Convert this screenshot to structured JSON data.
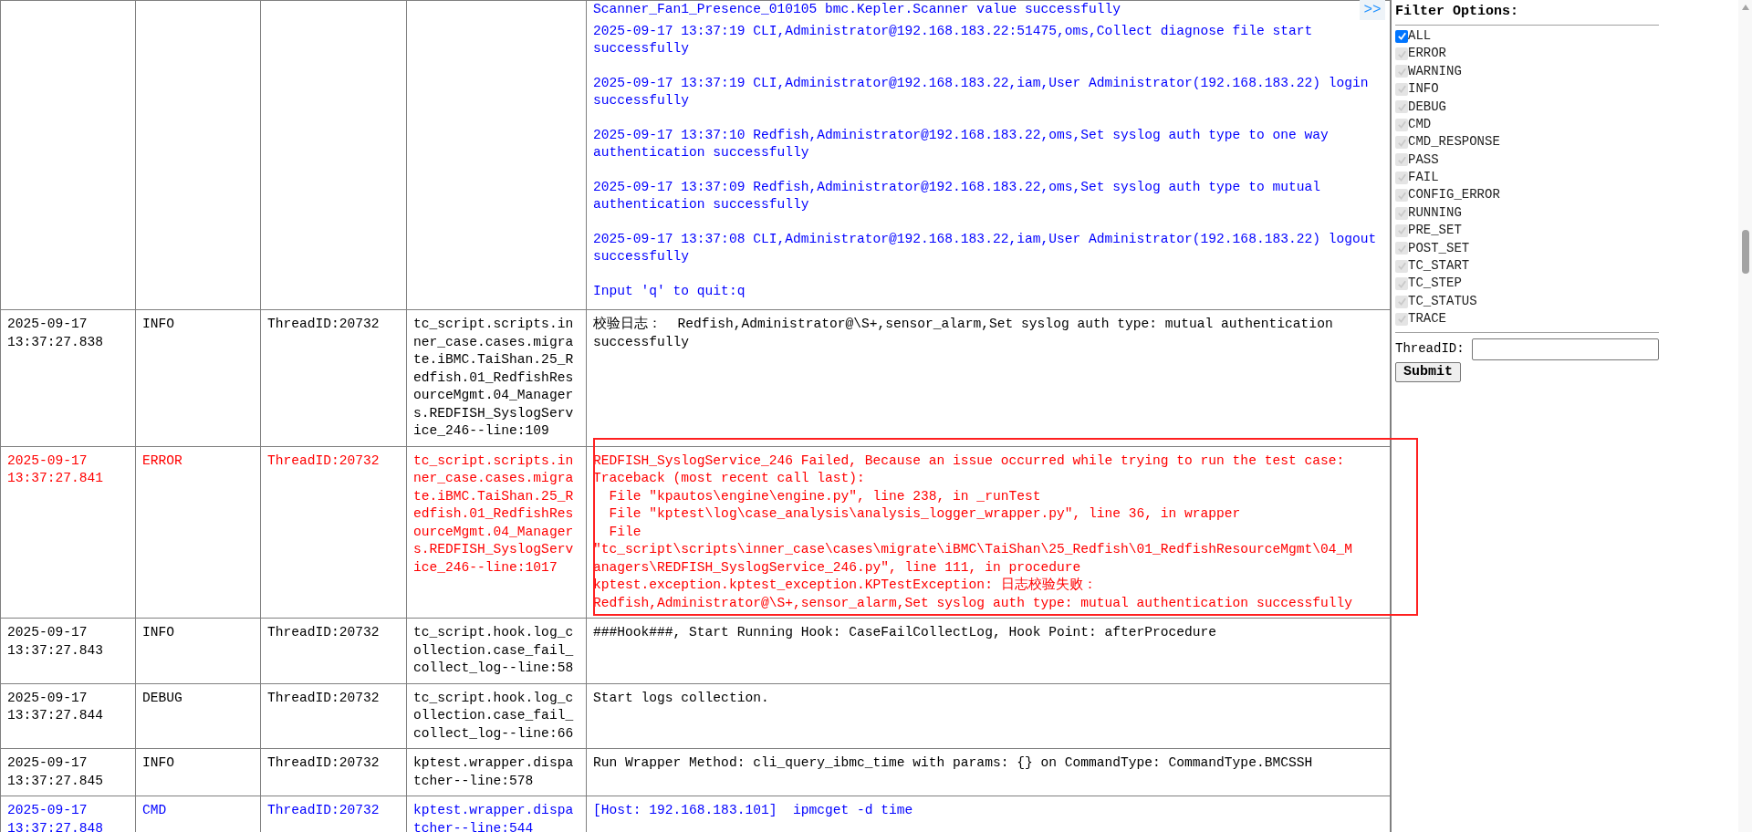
{
  "toggle": {
    "label": ">>"
  },
  "rows": [
    {
      "kind": "response",
      "color": "#0000ff",
      "highlighted": false,
      "message": [
        "Scanner_Fan1_Presence_010105 bmc.Kepler.Scanner value successfully",
        "2025-09-17 13:37:19 CLI,Administrator@192.168.183.22:51475,oms,Collect diagnose file start successfully",
        "2025-09-17 13:37:19 CLI,Administrator@192.168.183.22,iam,User Administrator(192.168.183.22) login successfully",
        "2025-09-17 13:37:10 Redfish,Administrator@192.168.183.22,oms,Set syslog auth type to one way authentication successfully",
        "2025-09-17 13:37:09 Redfish,Administrator@192.168.183.22,oms,Set syslog auth type to mutual authentication successfully",
        "2025-09-17 13:37:08 CLI,Administrator@192.168.183.22,iam,User Administrator(192.168.183.22) logout successfully",
        "Input 'q' to quit:q"
      ]
    },
    {
      "kind": "plain",
      "color": "#000000",
      "highlighted": false,
      "time": "2025-09-17 13:37:27.838",
      "level": "INFO",
      "thread": "ThreadID:20732",
      "source": "tc_script.scripts.inner_case.cases.migrate.iBMC.TaiShan.25_Redfish.01_RedfishResourceMgmt.04_Managers.REDFISH_SyslogService_246--line:109",
      "message": [
        "校验日志：  Redfish,Administrator@\\S+,sensor_alarm,Set syslog auth type: mutual authentication successfully"
      ]
    },
    {
      "kind": "plain",
      "color": "#ff0000",
      "highlighted": true,
      "time": "2025-09-17 13:37:27.841",
      "level": "ERROR",
      "thread": "ThreadID:20732",
      "source": "tc_script.scripts.inner_case.cases.migrate.iBMC.TaiShan.25_Redfish.01_RedfishResourceMgmt.04_Managers.REDFISH_SyslogService_246--line:1017",
      "message": [
        "REDFISH_SyslogService_246 Failed, Because an issue occurred while trying to run the test case:",
        "Traceback (most recent call last):",
        "  File \"kpautos\\engine\\engine.py\", line 238, in _runTest",
        "  File \"kptest\\log\\case_analysis\\analysis_logger_wrapper.py\", line 36, in wrapper",
        "  File",
        "\"tc_script\\scripts\\inner_case\\cases\\migrate\\iBMC\\TaiShan\\25_Redfish\\01_RedfishResourceMgmt\\04_M",
        "anagers\\REDFISH_SyslogService_246.py\", line 111, in procedure",
        "kptest.exception.kptest_exception.KPTestException: 日志校验失败：",
        "Redfish,Administrator@\\S+,sensor_alarm,Set syslog auth type: mutual authentication successfully"
      ]
    },
    {
      "kind": "plain",
      "color": "#000000",
      "highlighted": false,
      "time": "2025-09-17 13:37:27.843",
      "level": "INFO",
      "thread": "ThreadID:20732",
      "source": "tc_script.hook.log_collection.case_fail_collect_log--line:58",
      "message": [
        "###Hook###, Start Running Hook: CaseFailCollectLog, Hook Point: afterProcedure"
      ]
    },
    {
      "kind": "plain",
      "color": "#000000",
      "highlighted": false,
      "time": "2025-09-17 13:37:27.844",
      "level": "DEBUG",
      "thread": "ThreadID:20732",
      "source": "tc_script.hook.log_collection.case_fail_collect_log--line:66",
      "message": [
        "Start logs collection."
      ]
    },
    {
      "kind": "plain",
      "color": "#000000",
      "highlighted": false,
      "time": "2025-09-17 13:37:27.845",
      "level": "INFO",
      "thread": "ThreadID:20732",
      "source": "kptest.wrapper.dispatcher--line:578",
      "message": [
        "Run Wrapper Method: cli_query_ibmc_time with params: {} on CommandType: CommandType.BMCSSH"
      ]
    },
    {
      "kind": "plain",
      "color": "#0000ff",
      "highlighted": false,
      "time": "2025-09-17 13:37:27.848",
      "level": "CMD",
      "thread": "ThreadID:20732",
      "source": "kptest.wrapper.dispatcher--line:544",
      "message": [
        "[Host: 192.168.183.101]  ipmcget -d time"
      ]
    }
  ],
  "filter_panel": {
    "title": "Filter Options:",
    "filters": [
      {
        "label": "ALL",
        "checked": true,
        "disabled": false
      },
      {
        "label": "ERROR",
        "checked": true,
        "disabled": true
      },
      {
        "label": "WARNING",
        "checked": true,
        "disabled": true
      },
      {
        "label": "INFO",
        "checked": true,
        "disabled": true
      },
      {
        "label": "DEBUG",
        "checked": true,
        "disabled": true
      },
      {
        "label": "CMD",
        "checked": true,
        "disabled": true
      },
      {
        "label": "CMD_RESPONSE",
        "checked": true,
        "disabled": true
      },
      {
        "label": "PASS",
        "checked": true,
        "disabled": true
      },
      {
        "label": "FAIL",
        "checked": true,
        "disabled": true
      },
      {
        "label": "CONFIG_ERROR",
        "checked": true,
        "disabled": true
      },
      {
        "label": "RUNNING",
        "checked": true,
        "disabled": true
      },
      {
        "label": "PRE_SET",
        "checked": true,
        "disabled": true
      },
      {
        "label": "POST_SET",
        "checked": true,
        "disabled": true
      },
      {
        "label": "TC_START",
        "checked": true,
        "disabled": true
      },
      {
        "label": "TC_STEP",
        "checked": true,
        "disabled": true
      },
      {
        "label": "TC_STATUS",
        "checked": true,
        "disabled": true
      },
      {
        "label": "TRACE",
        "checked": true,
        "disabled": true
      }
    ],
    "thread_label": "ThreadID:",
    "submit": "Submit"
  }
}
